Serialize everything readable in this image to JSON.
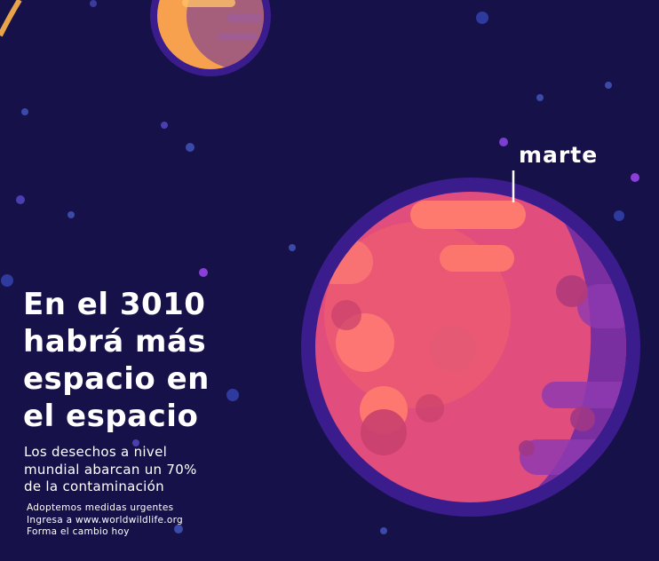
{
  "planet": {
    "name": "marte"
  },
  "headline": {
    "lines": [
      "En el 3010",
      "habrá más",
      "espacio en",
      "el espacio"
    ]
  },
  "subtext": {
    "lines": [
      "Los desechos a nivel",
      "mundial abarcan un 70%",
      "de la contaminación"
    ]
  },
  "footer": {
    "lines": [
      "Adoptemos medidas urgentes",
      "Ingresa a www.worldwildlife.org",
      "Forma el cambio hoy"
    ]
  },
  "colors": {
    "background": "#17114a",
    "planet_ring": "#3b1c8c",
    "mars_body": "#e14d7c",
    "mars_light": "#f2636b",
    "mars_shadow": "#7a2fa0",
    "small_planet": "#f7a04d"
  }
}
